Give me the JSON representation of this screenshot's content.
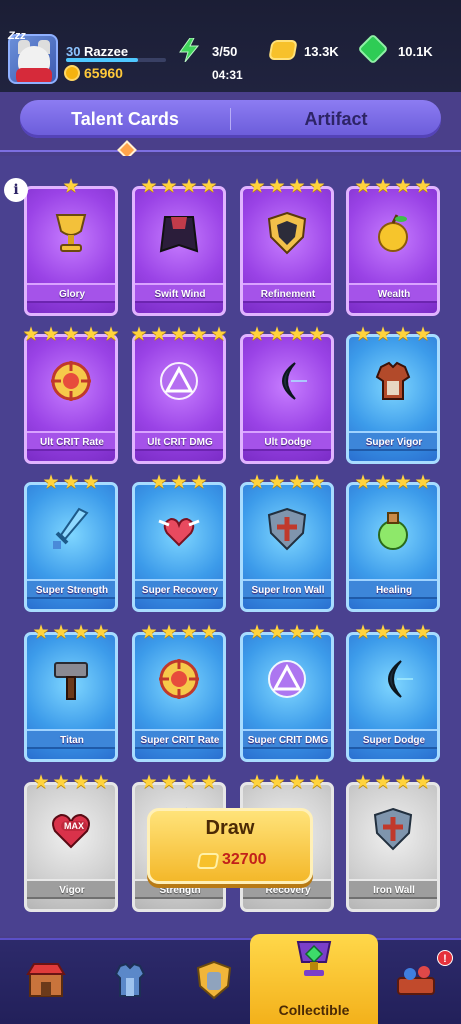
{
  "player": {
    "level": "30",
    "name": "Razzee",
    "xp_progress": 0.72,
    "coins": "65960",
    "sleep_text": "Zzz"
  },
  "resources": {
    "energy": "3/50",
    "energy_timer": "04:31",
    "gold": "13.3K",
    "gems": "10.1K"
  },
  "tabs": [
    {
      "label": "Talent Cards",
      "active": true
    },
    {
      "label": "Artifact",
      "active": false
    }
  ],
  "info_glyph": "i",
  "cards": [
    {
      "name": "Glory",
      "stars": 1,
      "rarity": "purple",
      "icon": "chalice-icon"
    },
    {
      "name": "Swift Wind",
      "stars": 4,
      "rarity": "purple",
      "icon": "cape-icon"
    },
    {
      "name": "Refinement",
      "stars": 4,
      "rarity": "purple",
      "icon": "shield-icon"
    },
    {
      "name": "Wealth",
      "stars": 4,
      "rarity": "purple",
      "icon": "golden-apple-icon"
    },
    {
      "name": "Ult CRIT Rate",
      "stars": 5,
      "rarity": "purple",
      "icon": "crosshair-icon"
    },
    {
      "name": "Ult CRIT DMG",
      "stars": 5,
      "rarity": "purple",
      "icon": "triangle-target-icon"
    },
    {
      "name": "Ult Dodge",
      "stars": 4,
      "rarity": "purple",
      "icon": "crescent-icon"
    },
    {
      "name": "Super Vigor",
      "stars": 4,
      "rarity": "blue",
      "icon": "armor-icon"
    },
    {
      "name": "Super Strength",
      "stars": 3,
      "rarity": "blue",
      "icon": "sword-icon"
    },
    {
      "name": "Super Recovery",
      "stars": 3,
      "rarity": "blue",
      "icon": "winged-heart-icon"
    },
    {
      "name": "Super Iron Wall",
      "stars": 4,
      "rarity": "blue",
      "icon": "cross-shield-icon"
    },
    {
      "name": "Healing",
      "stars": 4,
      "rarity": "blue",
      "icon": "potion-icon"
    },
    {
      "name": "Titan",
      "stars": 4,
      "rarity": "blue",
      "icon": "hammer-icon"
    },
    {
      "name": "Super CRIT Rate",
      "stars": 4,
      "rarity": "blue",
      "icon": "crosshair-icon"
    },
    {
      "name": "Super CRIT DMG",
      "stars": 4,
      "rarity": "blue",
      "icon": "triangle-target-icon"
    },
    {
      "name": "Super Dodge",
      "stars": 4,
      "rarity": "blue",
      "icon": "crescent-icon"
    },
    {
      "name": "Vigor",
      "stars": 4,
      "rarity": "grey",
      "icon": "max-heart-icon",
      "badge": "MAX"
    },
    {
      "name": "Strength",
      "stars": 4,
      "rarity": "grey",
      "icon": "sword-icon"
    },
    {
      "name": "Recovery",
      "stars": 4,
      "rarity": "grey",
      "icon": "heart-icon"
    },
    {
      "name": "Iron Wall",
      "stars": 4,
      "rarity": "grey",
      "icon": "cross-shield-icon"
    }
  ],
  "draw": {
    "label": "Draw",
    "cost": "32700"
  },
  "bottom_nav": [
    {
      "id": "shop",
      "icon": "shop-icon",
      "label": "",
      "active": false
    },
    {
      "id": "equipment",
      "icon": "armor-icon",
      "label": "",
      "active": false
    },
    {
      "id": "heroes",
      "icon": "knight-shield-icon",
      "label": "",
      "active": false
    },
    {
      "id": "collectible",
      "icon": "trophy-cup-icon",
      "label": "Collectible",
      "active": true
    },
    {
      "id": "battle",
      "icon": "battle-table-icon",
      "label": "",
      "active": false,
      "badge": "!"
    }
  ],
  "colors": {
    "accent_gold": "#f4b82a",
    "tab_purple": "#7a6ae6",
    "coin_text": "#ffc93a",
    "draw_cost": "#c2211a"
  }
}
